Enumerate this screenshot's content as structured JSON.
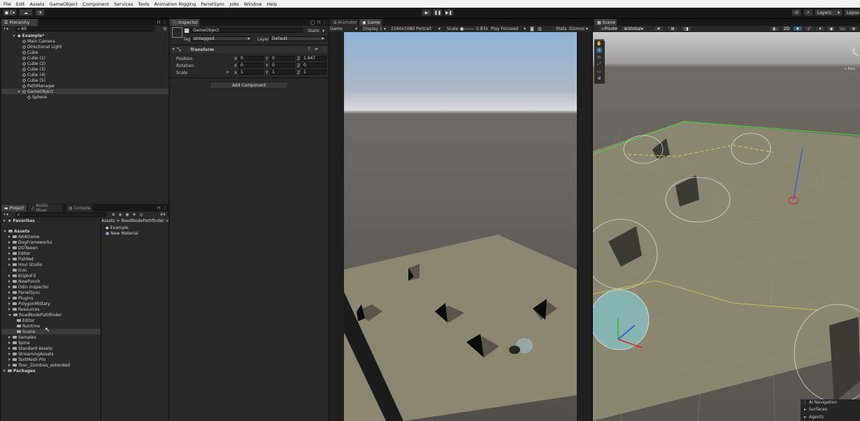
{
  "menu": [
    "File",
    "Edit",
    "Assets",
    "GameObject",
    "Component",
    "Services",
    "Tools",
    "Animation Rigging",
    "ParrelSync",
    "Jobs",
    "Window",
    "Help"
  ],
  "toolbar": {
    "account": "C",
    "layers": "Layers",
    "layout": "Layou"
  },
  "hierarchy": {
    "tab": "Hierarchy",
    "search_placeholder": "All",
    "scene": "Example*",
    "items": [
      "Main Camera",
      "Directional Light",
      "Cube",
      "Cube (1)",
      "Cube (2)",
      "Cube (3)",
      "Cube (4)",
      "Cube (5)",
      "PathManager",
      "GameObject",
      "Sphere"
    ]
  },
  "inspector": {
    "tab": "Inspector",
    "object_name": "GameObject",
    "static_label": "Static",
    "tag_label": "Tag",
    "tag_value": "Untagged",
    "layer_label": "Layer",
    "layer_value": "Default",
    "component": "Transform",
    "position_label": "Position",
    "rotation_label": "Rotation",
    "scale_label": "Scale",
    "x": "X",
    "y": "Y",
    "z": "Z",
    "pos": [
      "0",
      "0",
      "1.947"
    ],
    "rot": [
      "0",
      "0",
      "0"
    ],
    "scl": [
      "1",
      "1",
      "1"
    ],
    "add_component": "Add Component"
  },
  "project": {
    "tabs": [
      "Project",
      "Audio Mixer",
      "Console"
    ],
    "count": "44",
    "favorites": "Favorites",
    "assets": "Assets",
    "folders": [
      "AAAGame",
      "DogFrameworks",
      "DOTween",
      "Editor",
      "FishNet",
      "Hovl Studio",
      "Icon",
      "KriptoFX",
      "NewPunch",
      "Odin Inspector",
      "ParrelSync",
      "Plugins",
      "PolygonMilitary",
      "Resources",
      "RoadNodePathfinder",
      "Editor",
      "Runtime",
      "Scene",
      "Samples",
      "Spine",
      "Standard Assets",
      "StreamingAssets",
      "TextMesh Pro",
      "Toon_Zombies_extended"
    ],
    "packages": "Packages",
    "breadcrumb": "Assets > RoadNodePathfinder > S",
    "files": [
      "Example",
      "New Material"
    ]
  },
  "game": {
    "tabs": [
      "Animator",
      "Game"
    ],
    "mode": "Game",
    "display": "Display 1",
    "resolution": "2160x1080 Portrait",
    "scale_label": "Scale",
    "scale_value": "0.83x",
    "play_mode": "Play Focused",
    "stats": "Stats",
    "gizmos": "Gizmos"
  },
  "scene": {
    "tab": "Scene",
    "pivot": "Pivot",
    "global": "Global",
    "mode_2d": "2D",
    "persp": "< Pers",
    "overlay_title": "AI Navigation",
    "overlay_items": [
      "Surfaces",
      "Agents"
    ]
  }
}
